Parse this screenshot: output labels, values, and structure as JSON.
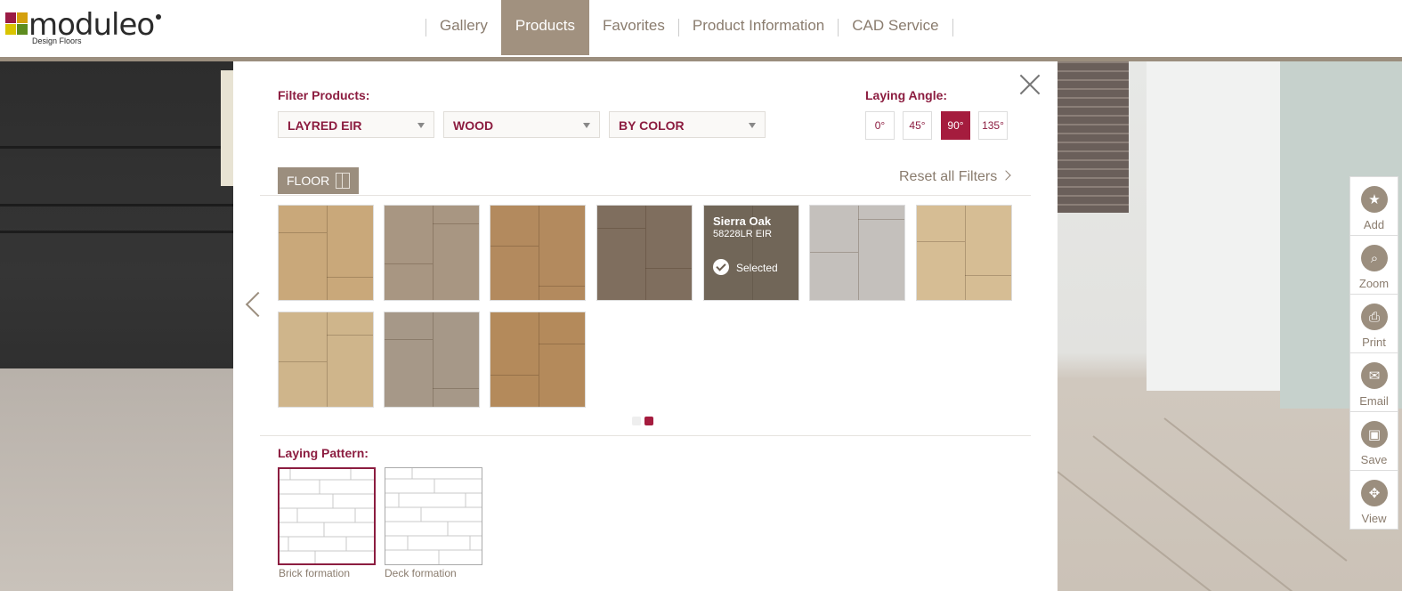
{
  "brand": {
    "name": "moduleo",
    "tagline": "Design Floors"
  },
  "nav": [
    {
      "label": "Gallery",
      "active": false
    },
    {
      "label": "Products",
      "active": true
    },
    {
      "label": "Favorites",
      "active": false
    },
    {
      "label": "Product Information",
      "active": false
    },
    {
      "label": "CAD Service",
      "active": false
    }
  ],
  "filters": {
    "title": "Filter Products:",
    "selects": [
      "LAYRED EIR",
      "WOOD",
      "BY COLOR"
    ]
  },
  "angle": {
    "title": "Laying Angle:",
    "options": [
      "0°",
      "45°",
      "90°",
      "135°"
    ],
    "selected": "90°"
  },
  "floor_tab": "FLOOR",
  "reset_label": "Reset all Filters",
  "selected_product": {
    "name": "Sierra Oak",
    "code": "58228LR EIR",
    "status": "Selected"
  },
  "swatch_colors": [
    "#c9a87a",
    "#a89682",
    "#b38a5e",
    "#7f6e5e",
    "#8e8270",
    "#c4c0bc",
    "#d6bd94",
    "#cfb58b",
    "#a69888",
    "#b48a5b"
  ],
  "pagination": {
    "pages": 2,
    "current": 2
  },
  "pattern": {
    "title": "Laying Pattern:",
    "options": [
      "Brick formation",
      "Deck formation"
    ],
    "selected": "Brick formation"
  },
  "toolbar": [
    {
      "label": "Add",
      "icon": "star-icon",
      "glyph": "★"
    },
    {
      "label": "Zoom",
      "icon": "magnifier-icon",
      "glyph": "⌕"
    },
    {
      "label": "Print",
      "icon": "printer-icon",
      "glyph": "⎙"
    },
    {
      "label": "Email",
      "icon": "envelope-icon",
      "glyph": "✉"
    },
    {
      "label": "Save",
      "icon": "save-icon",
      "glyph": "▣"
    },
    {
      "label": "View",
      "icon": "expand-icon",
      "glyph": "✥"
    }
  ],
  "colors": {
    "accent": "#8c1d40",
    "brand_taupe": "#9b8e7e"
  }
}
